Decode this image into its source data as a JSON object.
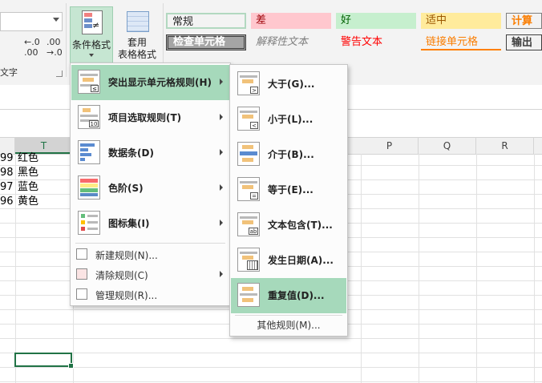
{
  "ribbon": {
    "font_group_fragment": "文字",
    "cond_format_label": "条件格式",
    "table_format_label1": "套用",
    "table_format_label2": "表格格式",
    "styles": [
      {
        "label": "常规",
        "bg": "#ffffff",
        "color": "#000000"
      },
      {
        "label": "差",
        "bg": "#ffc7ce",
        "color": "#9c0006"
      },
      {
        "label": "好",
        "bg": "#c6efce",
        "color": "#006100"
      },
      {
        "label": "适中",
        "bg": "#ffeb9c",
        "color": "#9c5700"
      },
      {
        "label": "计算",
        "bg": "#f2f2f2",
        "color": "#fa7d00"
      },
      {
        "label": "检查单元格",
        "bg": "#a5a5a5",
        "color": "#ffffff"
      },
      {
        "label": "解释性文本",
        "bg": "#ffffff",
        "color": "#7f7f7f"
      },
      {
        "label": "警告文本",
        "bg": "#ffffff",
        "color": "#ff0000"
      },
      {
        "label": "链接单元格",
        "bg": "#ffffff",
        "color": "#fa7d00"
      },
      {
        "label": "输出",
        "bg": "#f2f2f2",
        "color": "#3f3f3f"
      }
    ]
  },
  "columns": [
    "T",
    "P",
    "Q",
    "R"
  ],
  "rows": [
    {
      "num": "99",
      "value": "红色"
    },
    {
      "num": "98",
      "value": "黑色"
    },
    {
      "num": "97",
      "value": "蓝色"
    },
    {
      "num": "96",
      "value": "黄色"
    }
  ],
  "main_menu": {
    "items": [
      {
        "label": "突出显示单元格规则(H)",
        "icon": "highlight-rules-icon"
      },
      {
        "label": "项目选取规则(T)",
        "icon": "top-bottom-rules-icon"
      },
      {
        "label": "数据条(D)",
        "icon": "data-bars-icon"
      },
      {
        "label": "色阶(S)",
        "icon": "color-scales-icon"
      },
      {
        "label": "图标集(I)",
        "icon": "icon-sets-icon"
      }
    ],
    "small_items": [
      {
        "label": "新建规则(N)...",
        "icon": "new-rule-icon"
      },
      {
        "label": "清除规则(C)",
        "icon": "clear-rules-icon"
      },
      {
        "label": "管理规则(R)...",
        "icon": "manage-rules-icon"
      }
    ]
  },
  "sub_menu": {
    "items": [
      {
        "label": "大于(G)...",
        "icon": "greater-than-icon"
      },
      {
        "label": "小于(L)...",
        "icon": "less-than-icon"
      },
      {
        "label": "介于(B)...",
        "icon": "between-icon"
      },
      {
        "label": "等于(E)...",
        "icon": "equal-to-icon"
      },
      {
        "label": "文本包含(T)...",
        "icon": "text-contains-icon"
      },
      {
        "label": "发生日期(A)...",
        "icon": "date-occurring-icon"
      },
      {
        "label": "重复值(D)...",
        "icon": "duplicate-values-icon"
      }
    ],
    "more_rules": "其他规则(M)..."
  },
  "icon_glyphs": {
    "greater": ">",
    "less": "<",
    "equal": "=",
    "ab": "ab",
    "ten": "10",
    "neq": "≠",
    "decimals_more": "←.0 .00",
    "decimals_less": ".00 →.0",
    "sign": "≤"
  }
}
